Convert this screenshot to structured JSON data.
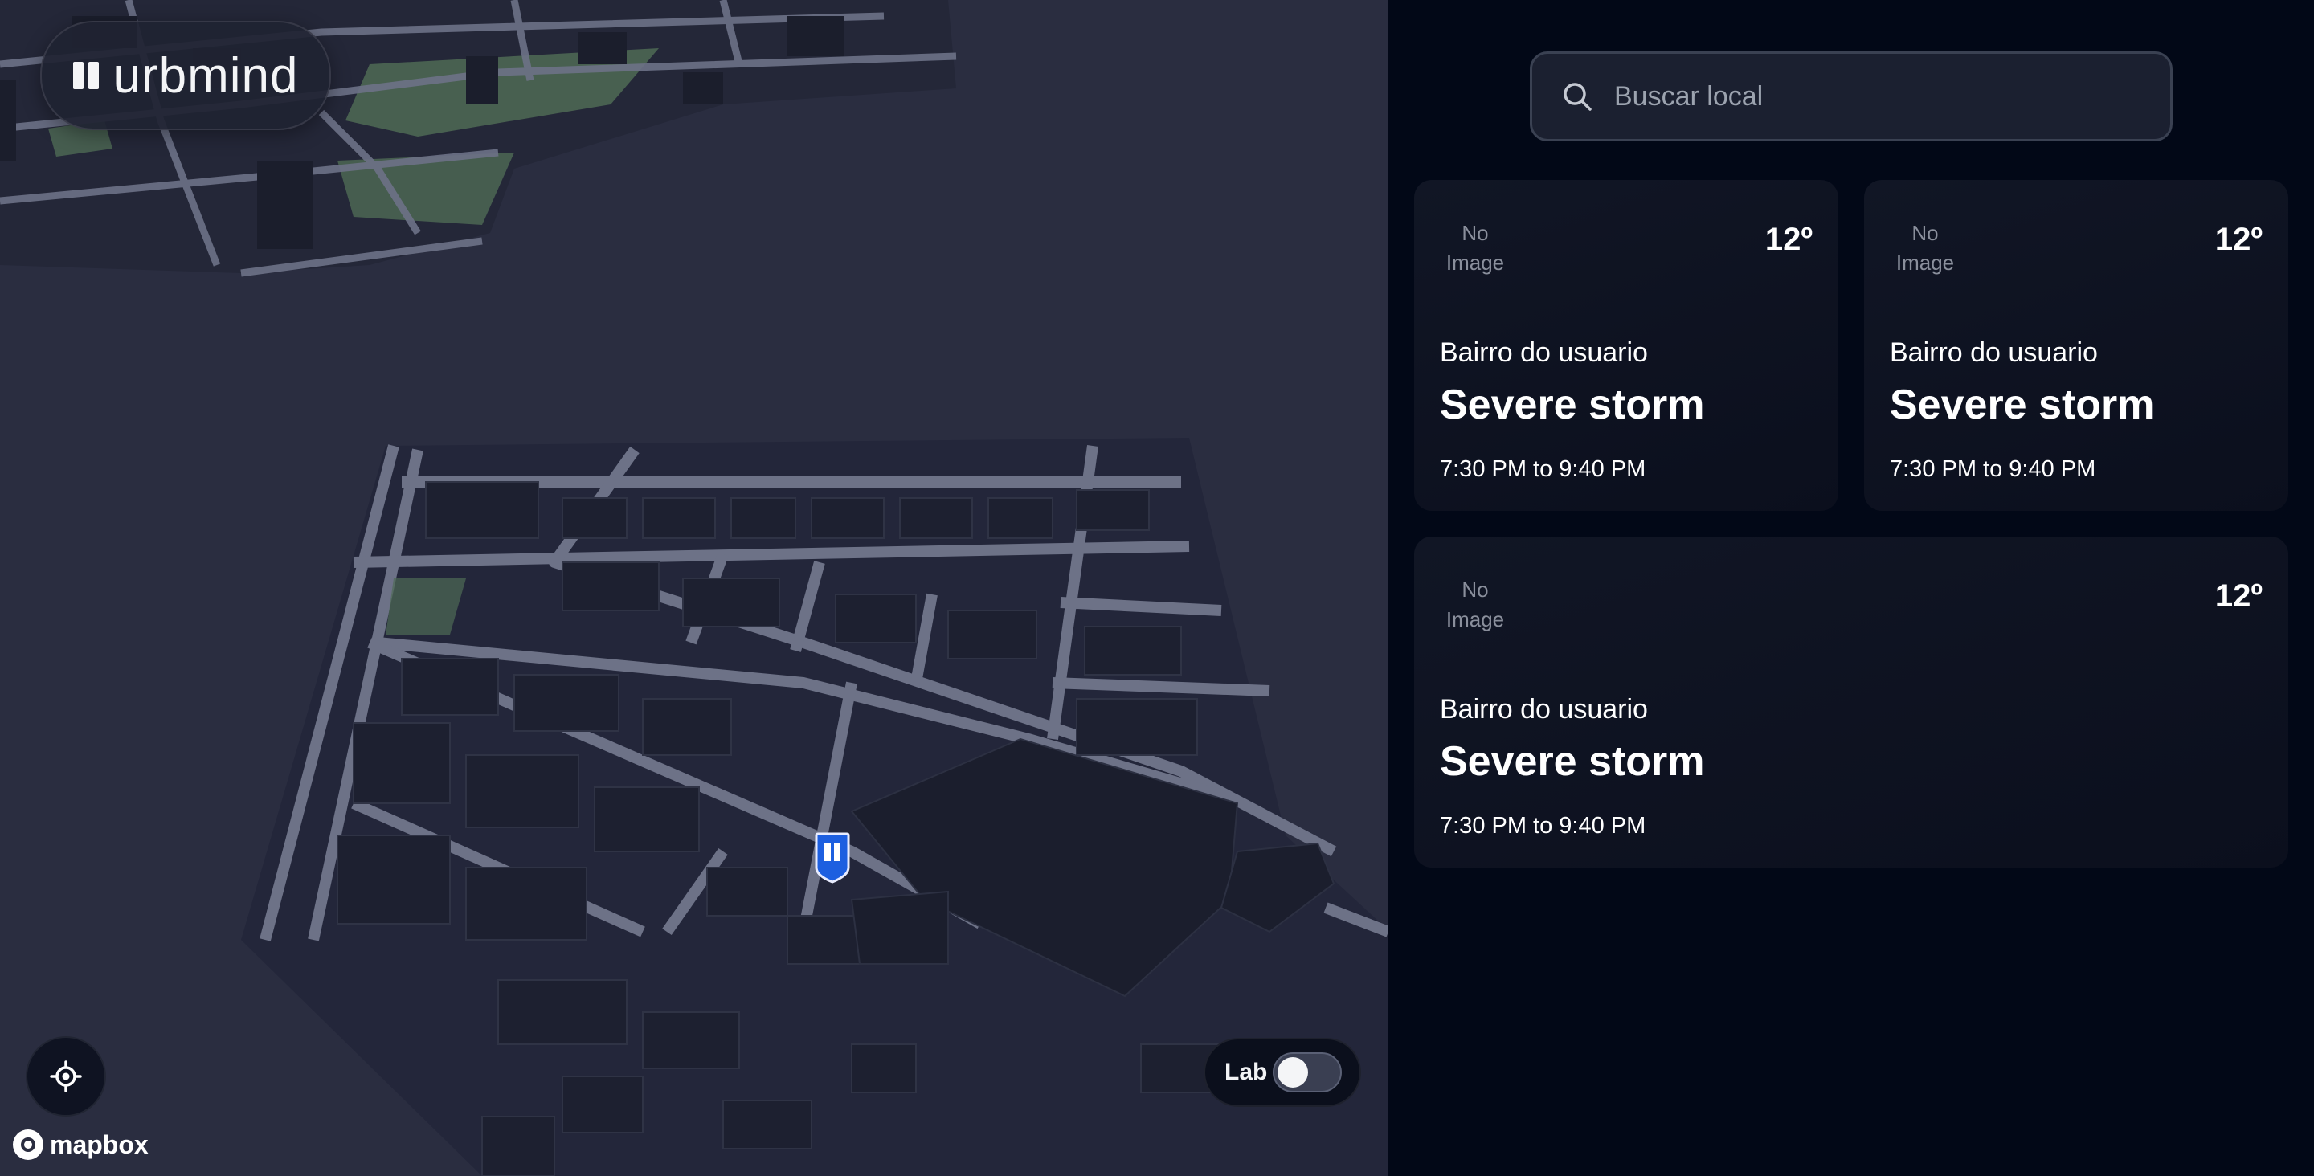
{
  "brand": {
    "name": "urbmind"
  },
  "map": {
    "attribution": "mapbox",
    "lab_toggle": {
      "label": "Lab",
      "on": false
    },
    "colors": {
      "background": "#2a2d40",
      "roads": "#6d7287",
      "buildings": "#1f2231",
      "parks": "#4f6b55",
      "pin": "#1d5fe0"
    }
  },
  "search": {
    "placeholder": "Buscar local",
    "value": ""
  },
  "cards": [
    {
      "image_text": "No Image",
      "temperature": "12º",
      "place": "Bairro do usuario",
      "condition": "Severe storm",
      "time": "7:30 PM to 9:40 PM"
    },
    {
      "image_text": "No Image",
      "temperature": "12º",
      "place": "Bairro do usuario",
      "condition": "Severe storm",
      "time": "7:30 PM to 9:40 PM"
    },
    {
      "image_text": "No Image",
      "temperature": "12º",
      "place": "Bairro do usuario",
      "condition": "Severe storm",
      "time": "7:30 PM to 9:40 PM"
    }
  ],
  "icons": {
    "search": "search-icon",
    "locate": "locate-icon",
    "pin": "location-pin-icon",
    "logo": "urbmind-logo-mark"
  }
}
